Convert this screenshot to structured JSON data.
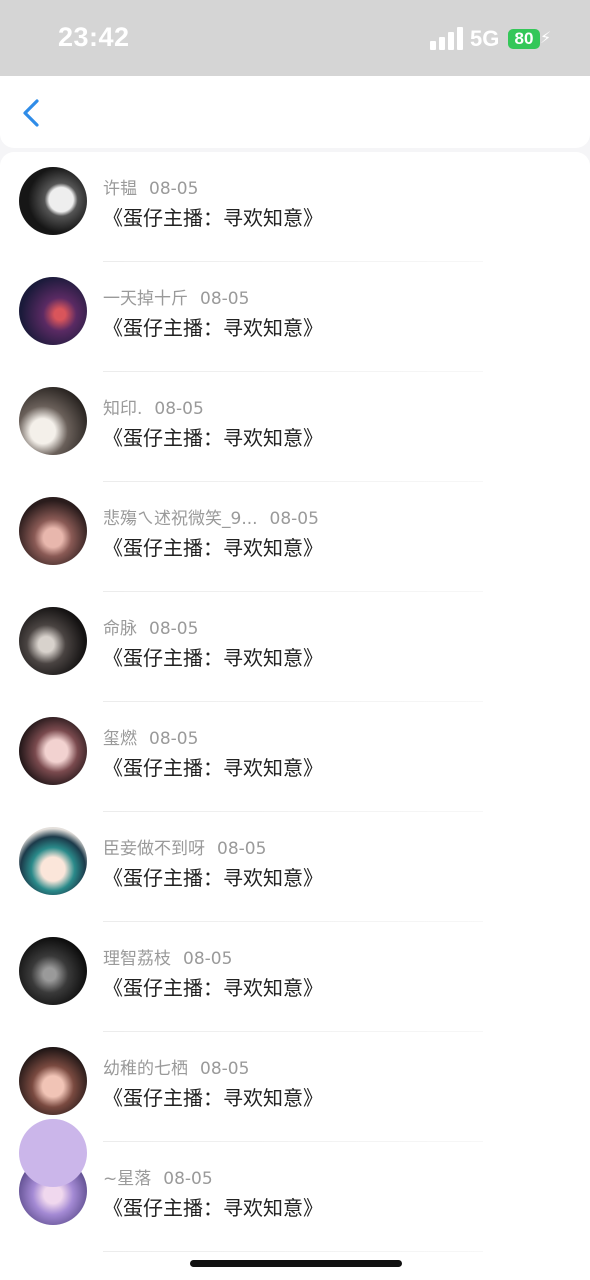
{
  "status_bar": {
    "time": "23:42",
    "network": "5G",
    "battery": "80"
  },
  "nav": {
    "back_icon": "chevron-left-icon",
    "accent_color": "#2f8ce8"
  },
  "items": [
    {
      "user": "许韫",
      "date": "08-05",
      "text": "《蛋仔主播：寻欢知意》"
    },
    {
      "user": "一天掉十斤",
      "date": "08-05",
      "text": "《蛋仔主播：寻欢知意》"
    },
    {
      "user": "知印.",
      "date": "08-05",
      "text": "《蛋仔主播：寻欢知意》"
    },
    {
      "user": "悲殤ㄟ述祝微笑_9...",
      "date": "08-05",
      "text": "《蛋仔主播：寻欢知意》"
    },
    {
      "user": "命脉",
      "date": "08-05",
      "text": "《蛋仔主播：寻欢知意》"
    },
    {
      "user": "玺燃",
      "date": "08-05",
      "text": "《蛋仔主播：寻欢知意》"
    },
    {
      "user": "臣妾做不到呀",
      "date": "08-05",
      "text": "《蛋仔主播：寻欢知意》"
    },
    {
      "user": "理智荔枝",
      "date": "08-05",
      "text": "《蛋仔主播：寻欢知意》"
    },
    {
      "user": "幼稚的七栖",
      "date": "08-05",
      "text": "《蛋仔主播：寻欢知意》"
    },
    {
      "user": "~星落",
      "date": "08-05",
      "text": "《蛋仔主播：寻欢知意》"
    }
  ]
}
